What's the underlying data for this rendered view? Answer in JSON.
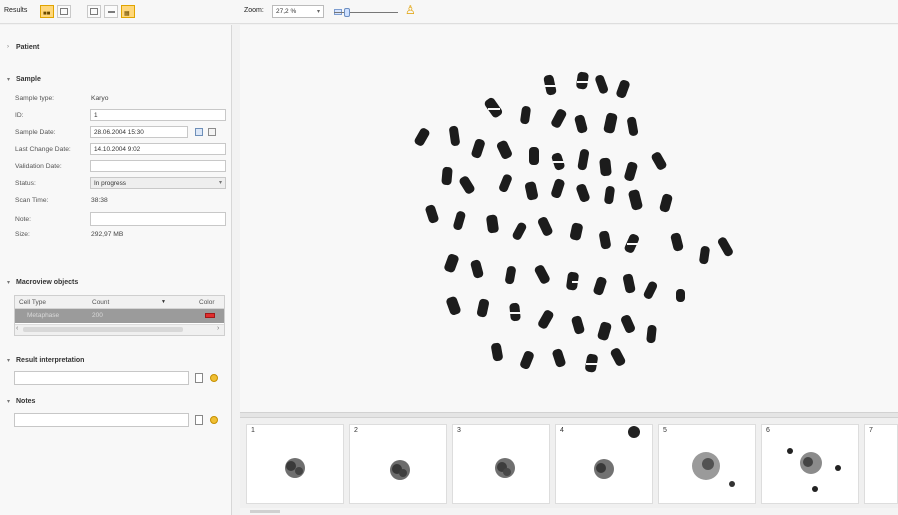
{
  "toolbar": {
    "results_label": "Results",
    "zoom_label": "Zoom:",
    "zoom_value": "27,2 %"
  },
  "left": {
    "patient_title": "Patient",
    "sample_title": "Sample",
    "fields": [
      {
        "label": "Sample type:",
        "value": "Karyo"
      },
      {
        "label": "ID:",
        "value": "1"
      },
      {
        "label": "Sample Date:",
        "value": "28.06.2004 15:30"
      },
      {
        "label": "Last Change Date:",
        "value": "14.10.2004 9:02"
      },
      {
        "label": "Validation Date:",
        "value": ""
      },
      {
        "label": "Status:",
        "value": "In progress"
      },
      {
        "label": "Scan Time:",
        "value": "38:38"
      },
      {
        "label": "Note:",
        "value": ""
      },
      {
        "label": "Size:",
        "value": "292,97 MB"
      }
    ],
    "macroview_title": "Macroview objects",
    "table": {
      "headers": [
        "Cell Type",
        "Count",
        "Color"
      ],
      "rows": [
        {
          "cell_type": "Metaphase",
          "count": "200",
          "color": "#e02e2e"
        }
      ]
    },
    "result_title": "Result interpretation",
    "notes_title": "Notes"
  },
  "thumbnails": [
    {
      "num": "1"
    },
    {
      "num": "2"
    },
    {
      "num": "3"
    },
    {
      "num": "4"
    },
    {
      "num": "5"
    },
    {
      "num": "6"
    },
    {
      "num": "7"
    }
  ]
}
